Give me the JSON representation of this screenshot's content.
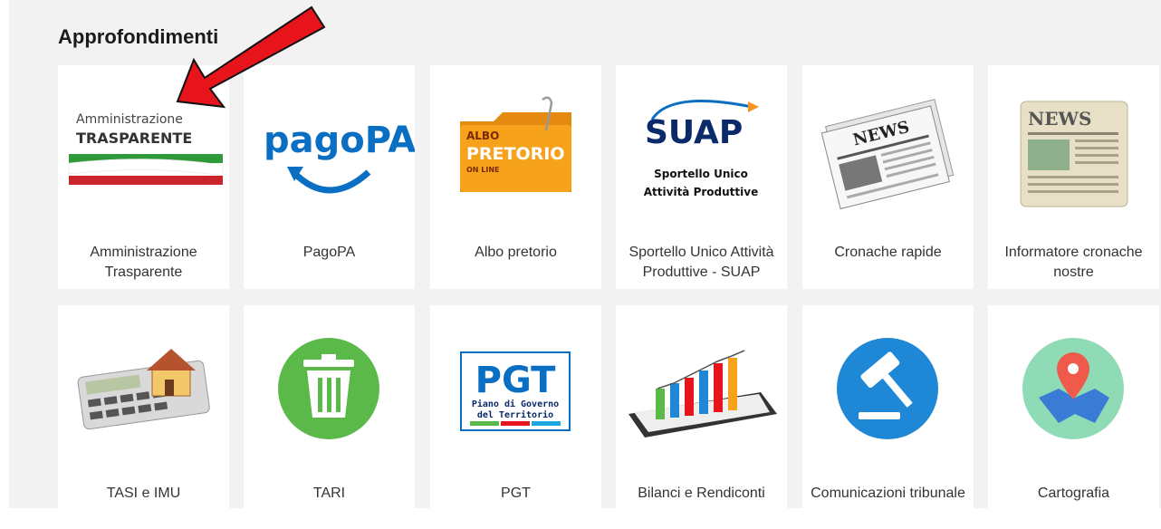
{
  "section": {
    "title": "Approfondimenti"
  },
  "logos": {
    "amm_trasparente": {
      "line1": "Amministrazione",
      "line2": "TRASPARENTE"
    },
    "pagopa": {
      "text": "pagoPA"
    },
    "albo": {
      "line1": "ALBO",
      "line2": "PRETORIO",
      "line3": "ON LINE"
    },
    "suap": {
      "title": "SUAP",
      "line1": "Sportello Unico",
      "line2": "Attività Produttive"
    },
    "news1": {
      "text": "NEWS"
    },
    "news2": {
      "text": "NEWS"
    },
    "pgt": {
      "title": "PGT",
      "line1": "Piano di Governo",
      "line2": "del Territorio"
    }
  },
  "cards": [
    {
      "label": "Amministrazione Trasparente"
    },
    {
      "label": "PagoPA"
    },
    {
      "label": "Albo pretorio"
    },
    {
      "label": "Sportello Unico Attività Produttive - SUAP"
    },
    {
      "label": "Cronache rapide"
    },
    {
      "label": "Informatore cronache nostre"
    },
    {
      "label": "TASI e IMU"
    },
    {
      "label": "TARI"
    },
    {
      "label": "PGT"
    },
    {
      "label": "Bilanci e Rendiconti"
    },
    {
      "label": "Comunicazioni tribunale"
    },
    {
      "label": "Cartografia"
    }
  ],
  "colors": {
    "accent_blue": "#0a6fc2",
    "albo_orange": "#f7a21b",
    "tari_green": "#5bb94a",
    "tribunale_blue": "#1e88d6",
    "map_green": "#8edbb5",
    "pin_red": "#f05a4a",
    "arrow_red": "#e8141b"
  }
}
